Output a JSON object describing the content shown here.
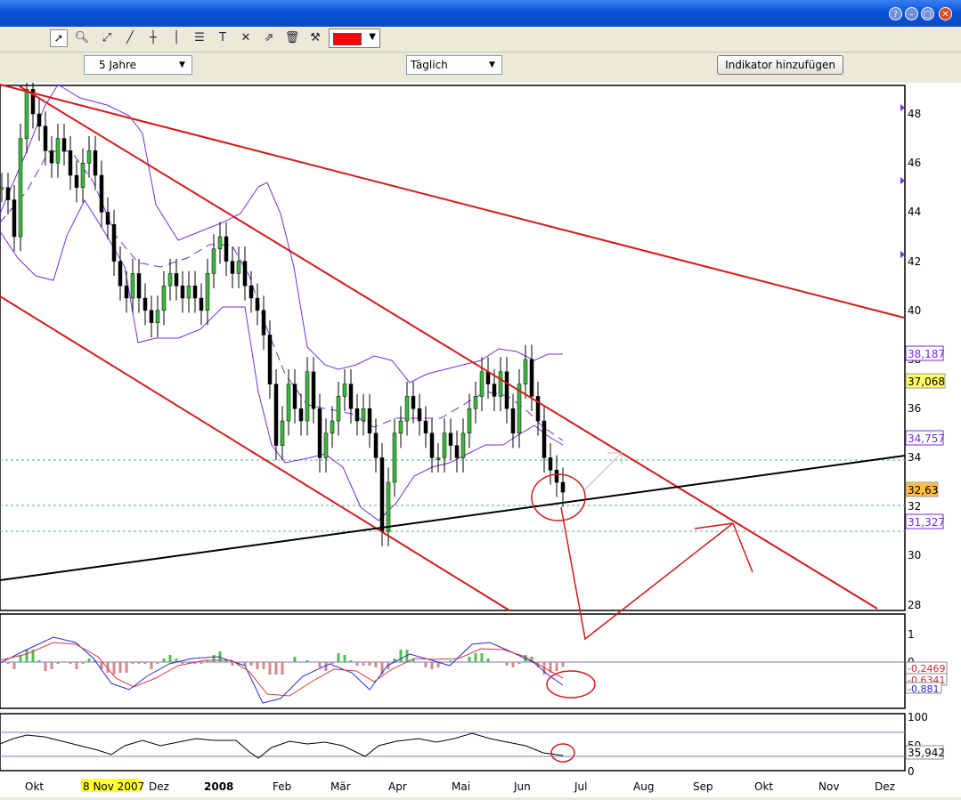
{
  "window": {
    "buttons": [
      "?",
      "–",
      "▢",
      "✕"
    ]
  },
  "toolbar": {
    "tools": [
      "cursor-icon",
      "zoom-icon",
      "trendline-icon",
      "line-icon",
      "horizontal-line-icon",
      "vertical-line-icon",
      "fibonacci-icon",
      "text-icon",
      "cross-line-icon",
      "channel-icon",
      "trash-icon",
      "settings-icon"
    ],
    "color": "#ff0000"
  },
  "controls": {
    "period": "5 Jahre",
    "interval": "Täglich",
    "add_indicator": "Indikator hinzufügen"
  },
  "chart_data": {
    "type": "candlestick",
    "price_axis": [
      "48",
      "46",
      "44",
      "42",
      "40",
      "38",
      "36",
      "34",
      "32",
      "30",
      "28"
    ],
    "price_labels": {
      "bb_upper": "38,187",
      "last_close": "37,068",
      "bb_mid": "34,757",
      "current": "32,63",
      "bb_lower": "31,327"
    },
    "macd_axis": [
      "1",
      "0"
    ],
    "macd_labels": [
      "-0,2469",
      "-0,6341",
      "-0,881"
    ],
    "rsi_axis": [
      "100",
      "50",
      "0"
    ],
    "rsi_label": "35,942",
    "x_labels": [
      "Okt",
      "8 Nov 2007",
      "Dez",
      "2008",
      "Feb",
      "Mär",
      "Apr",
      "Mai",
      "Jun",
      "Jul",
      "Aug",
      "Sep",
      "Okt",
      "Nov",
      "Dez"
    ],
    "highlight_x_label": "8 Nov 2007",
    "ohlc": [
      45.0,
      44.5,
      43.0,
      47.0,
      49.0,
      48.0,
      47.5,
      46.5,
      46.0,
      47.0,
      46.5,
      45.5,
      45.0,
      46.0,
      46.5,
      45.5,
      44.0,
      43.5,
      42.0,
      41.0,
      40.5,
      41.5,
      40.5,
      40.0,
      39.5,
      40.0,
      41.0,
      41.5,
      41.0,
      40.5,
      41.0,
      40.5,
      40.0,
      41.5,
      42.5,
      43.0,
      42.0,
      41.5,
      42.0,
      41.0,
      40.5,
      40.0,
      39.0,
      37.0,
      34.5,
      35.5,
      37.0,
      36.0,
      35.5,
      37.5,
      36.0,
      34.0,
      35.0,
      35.5,
      36.5,
      37.0,
      36.0,
      35.5,
      36.0,
      35.0,
      34.0,
      31.0,
      33.0,
      35.0,
      35.5,
      36.5,
      36.0,
      35.5,
      35.0,
      34.0,
      34.0,
      35.0,
      34.5,
      34.0,
      35.0,
      36.0,
      36.5,
      37.5,
      37.0,
      36.5,
      37.5,
      36.0,
      35.0,
      37.0,
      38.0,
      36.5,
      35.5,
      34.0,
      33.5,
      33.0,
      32.6
    ]
  }
}
